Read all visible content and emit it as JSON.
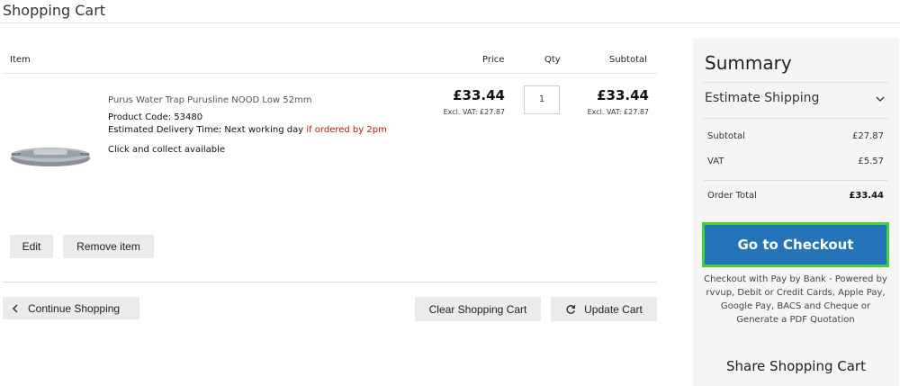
{
  "page": {
    "title": "Shopping Cart"
  },
  "cart": {
    "headers": {
      "item": "Item",
      "price": "Price",
      "qty": "Qty",
      "subtotal": "Subtotal"
    },
    "item": {
      "name": "Purus Water Trap Purusline NOOD Low 52mm",
      "product_code": "Product Code: 53480",
      "delivery_prefix": "Estimated Delivery Time: Next working day",
      "delivery_highlight": "if ordered by 2pm",
      "collect": "Click and collect available",
      "price": "£33.44",
      "price_excl": "Excl. VAT: £27.87",
      "qty": "1",
      "subtotal": "£33.44",
      "subtotal_excl": "Excl. VAT: £27.87",
      "edit_label": "Edit",
      "remove_label": "Remove item"
    },
    "actions": {
      "continue_label": "Continue Shopping",
      "clear_label": "Clear Shopping Cart",
      "update_label": "Update Cart"
    }
  },
  "summary": {
    "title": "Summary",
    "estimate_shipping": "Estimate Shipping",
    "rows": [
      {
        "label": "Subtotal",
        "value": "£27.87"
      },
      {
        "label": "VAT",
        "value": "£5.57"
      },
      {
        "label": "Order Total",
        "value": "£33.44"
      }
    ],
    "checkout_label": "Go to Checkout",
    "payment_note": "Checkout with Pay by Bank - Powered by rvvup, Debit or Credit Cards, Apple Pay, Google Pay, BACS and Cheque or Generate a PDF Quotation",
    "share_label": "Share Shopping Cart"
  },
  "colors": {
    "checkout_bg": "#2574b8",
    "checkout_border": "#3ed23e",
    "delivery_highlight": "#cc1111"
  },
  "icons": {
    "estimate_toggle": "chevron-down-icon",
    "continue": "chevron-left-icon",
    "update": "refresh-icon"
  }
}
